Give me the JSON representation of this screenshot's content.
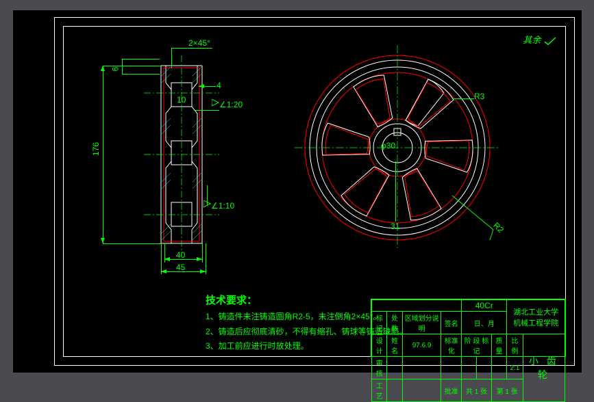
{
  "corner_mark": "其余",
  "dimensions": {
    "chamfer_top": "2×45°",
    "depth_4": "4",
    "depth_10": "10",
    "taper_top": "∠1:20",
    "taper_bottom": "∠1:10",
    "height_6": "6",
    "height_176": "176",
    "width_40": "40",
    "width_45": "45",
    "dia_30": "φ30",
    "r3": "R3",
    "r2": "R2",
    "key_31": "31"
  },
  "tech_req": {
    "title": "技术要求：",
    "line1": "1、铸造件未注铸造圆角R2-5，未注倒角2×45°。",
    "line2": "2、铸造后应彻底清砂，不得有缩孔、铸球等铸造缺陷。",
    "line3": "3、加工前应进行时放处理。"
  },
  "title_block": {
    "material": "40Cr",
    "school_line1": "湖北工业大学",
    "school_line2": "机械工程学院",
    "part_name": "小 齿 轮",
    "row_labels": {
      "mark": "标记",
      "zone": "处数",
      "desc": "区域划分说明",
      "sig": "签名",
      "date": "日、月",
      "design": "设计",
      "name": "姓名",
      "std": "标准化",
      "chk": "审核",
      "stage": "阶  段  标  记",
      "wt": "质量",
      "scale": "比例",
      "scale_val": "2:1",
      "sheet": "共 1 张",
      "sheet2": "第 1 张",
      "proc": "工艺",
      "appr": "批准",
      "date2": "97.6.9"
    }
  },
  "chart_data": {
    "type": "diagram",
    "description": "CAD engineering drawing",
    "views": [
      {
        "name": "section_view",
        "type": "cross-section",
        "overall_height": 176,
        "widths": [
          40,
          45
        ],
        "features": {
          "top_chamfer": "2×45°",
          "top_taper": "1:20",
          "bottom_taper": "1:10",
          "groove_depth_1": 4,
          "groove_depth_2": 10,
          "rib_thickness": 6
        }
      },
      {
        "name": "front_view",
        "type": "circular-face",
        "bore_diameter": 30,
        "keyway_width": 31,
        "spokes": 6,
        "fillets": {
          "inner": "R3",
          "outer": "R2"
        }
      }
    ],
    "material": "40Cr",
    "part": "小齿轮 (small gear)"
  }
}
